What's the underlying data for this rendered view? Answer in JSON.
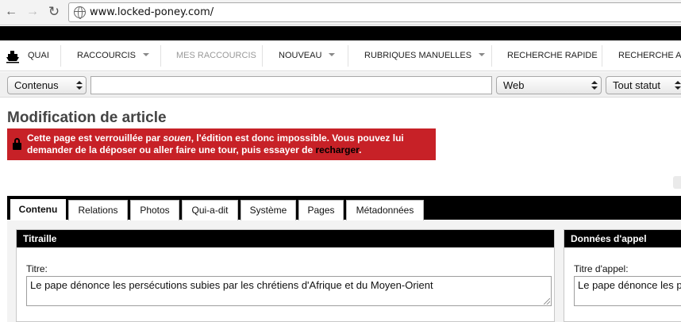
{
  "browser": {
    "url": "www.locked-poney.com/"
  },
  "menu": {
    "items": [
      {
        "label": "Quai"
      },
      {
        "label": "Raccourcis"
      },
      {
        "label": "Mes raccourcis"
      },
      {
        "label": "Nouveau"
      },
      {
        "label": "Rubriques manuelles"
      },
      {
        "label": "Recherche rapide"
      },
      {
        "label": "Recherche av"
      }
    ]
  },
  "search": {
    "type_value": "Contenus",
    "query_value": "",
    "channel_value": "Web",
    "status_value": "Tout statut"
  },
  "page": {
    "title": "Modification de article"
  },
  "alert": {
    "part1": "Cette page est verrouillée par ",
    "user": "souen",
    "part2": ", l'édition est donc impossible. Vous pouvez lui demander de la déposer ou aller faire une tour, puis essayer de ",
    "link": "recharger",
    "part3": "."
  },
  "tabs": [
    {
      "label": "Contenu",
      "active": true
    },
    {
      "label": "Relations"
    },
    {
      "label": "Photos"
    },
    {
      "label": "Qui-a-dit"
    },
    {
      "label": "Système"
    },
    {
      "label": "Pages"
    },
    {
      "label": "Métadonnées"
    }
  ],
  "panels": {
    "titraille": {
      "header": "Titraille",
      "label": "Titre:",
      "value": "Le pape dénonce les persécutions subies par les chrétiens d'Afrique et du Moyen-Orient"
    },
    "appel": {
      "header": "Données d'appel",
      "label": "Titre d'appel:",
      "value": "Le pape dénonce les persécutions subies par les chrétiens d'Afrique et du Moyen-Orient"
    }
  }
}
